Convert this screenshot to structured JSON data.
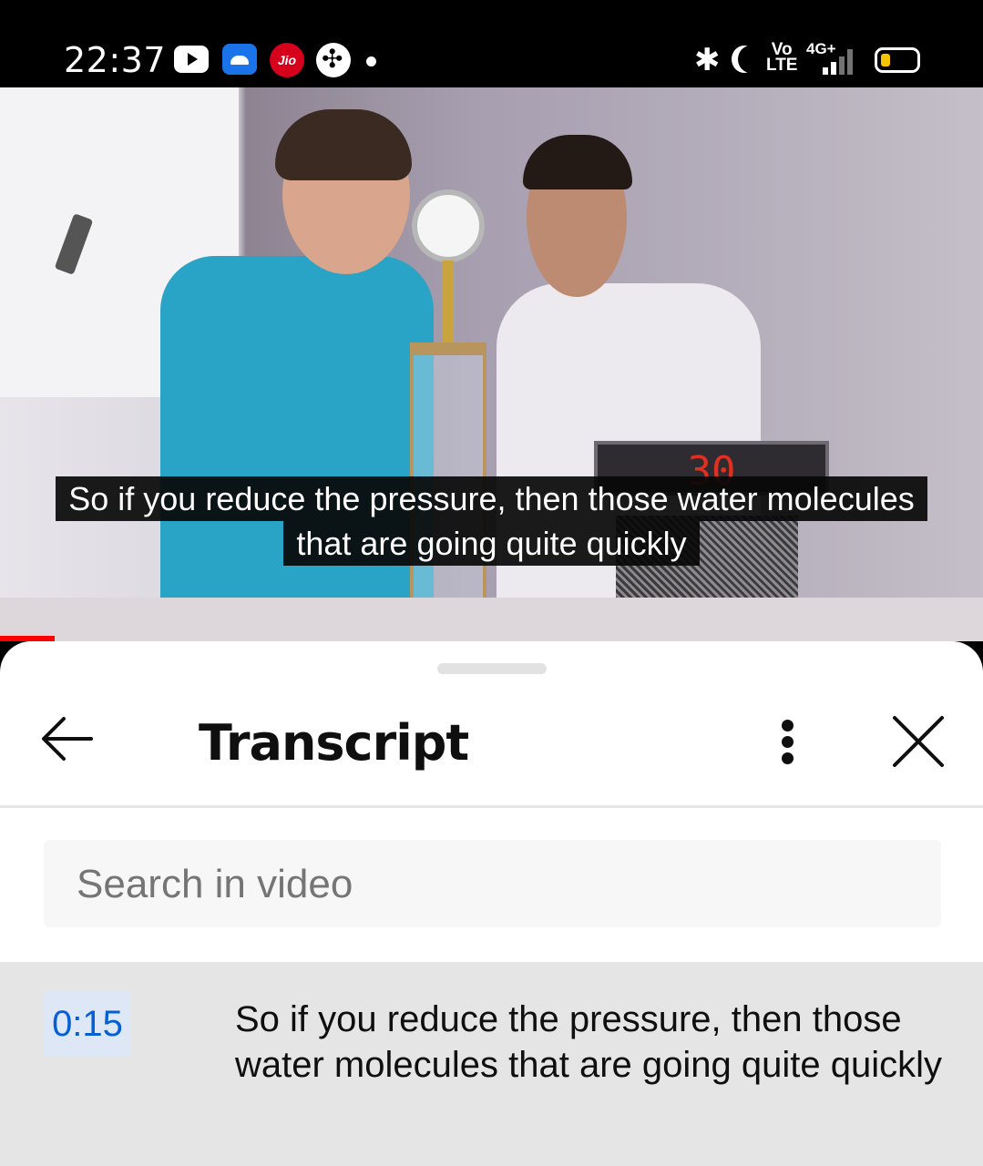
{
  "status_bar": {
    "time": "22:37",
    "app_icons": [
      "youtube-icon",
      "android-icon",
      "jio-icon",
      "game-icon",
      "dot-icon"
    ],
    "system_icons": [
      "bluetooth-icon",
      "do-not-disturb-icon",
      "volte-icon",
      "4g-icon",
      "signal-icon",
      "battery-icon"
    ],
    "volte_label_top": "Vo",
    "volte_label_bottom": "LTE",
    "network": "4G+"
  },
  "video": {
    "display_reading": "30",
    "caption_line_1": "So if you reduce the pressure, then those water molecules",
    "caption_line_2": "that are going quite quickly",
    "progress_color": "#ff0000"
  },
  "transcript_panel": {
    "title": "Transcript",
    "search_placeholder": "Search in video",
    "segments": [
      {
        "timestamp": "0:15",
        "text": "So if you reduce the pressure, then those water molecules that are going quite quickly"
      }
    ]
  },
  "colors": {
    "accent_link": "#065fd4",
    "active_segment_bg": "#e5e5e5",
    "timestamp_bg": "#dde7f6"
  }
}
